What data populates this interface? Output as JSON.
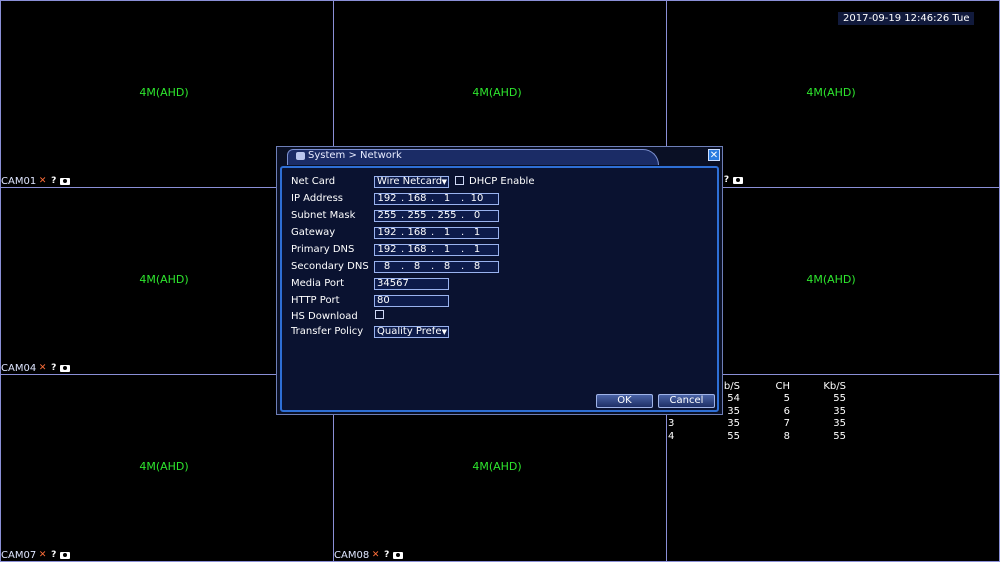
{
  "clock": "2017-09-19 12:46:26 Tue",
  "cells": [
    {
      "res": "4M(AHD)",
      "cam": "CAM01"
    },
    {
      "res": "4M(AHD)",
      "cam": ""
    },
    {
      "res": "4M(AHD)",
      "cam": ""
    },
    {
      "res": "4M(AHD)",
      "cam": "CAM04"
    },
    {
      "res": "",
      "cam": ""
    },
    {
      "res": "4M(AHD)",
      "cam": ""
    },
    {
      "res": "4M(AHD)",
      "cam": "CAM07"
    },
    {
      "res": "4M(AHD)",
      "cam": "CAM08"
    },
    {
      "res": "",
      "cam": ""
    }
  ],
  "stats": {
    "header": [
      "b/S",
      "CH",
      "Kb/S"
    ],
    "rows": [
      [
        "",
        "54",
        "5",
        "55"
      ],
      [
        "",
        "35",
        "6",
        "35"
      ],
      [
        "3",
        "35",
        "7",
        "35"
      ],
      [
        "4",
        "55",
        "8",
        "55"
      ]
    ]
  },
  "dialog": {
    "title": "System > Network",
    "close_glyph": "✕",
    "labels": {
      "net_card": "Net Card",
      "ip": "IP Address",
      "subnet": "Subnet Mask",
      "gateway": "Gateway",
      "primary_dns": "Primary DNS",
      "secondary_dns": "Secondary DNS",
      "media_port": "Media Port",
      "http_port": "HTTP Port",
      "hs_download": "HS Download",
      "transfer_policy": "Transfer Policy",
      "dhcp": "DHCP Enable"
    },
    "net_card_value": "Wire Netcard",
    "ip": [
      "192",
      "168",
      "1",
      "10"
    ],
    "subnet": [
      "255",
      "255",
      "255",
      "0"
    ],
    "gateway": [
      "192",
      "168",
      "1",
      "1"
    ],
    "primary_dns": [
      "192",
      "168",
      "1",
      "1"
    ],
    "secondary_dns": [
      "8",
      "8",
      "8",
      "8"
    ],
    "media_port": "34567",
    "http_port": "80",
    "transfer_policy_value": "Quality Prefe",
    "ok": "OK",
    "cancel": "Cancel"
  },
  "icons": {
    "mute": "speaker-muted-icon",
    "help": "question-icon",
    "record": "camera-icon"
  }
}
